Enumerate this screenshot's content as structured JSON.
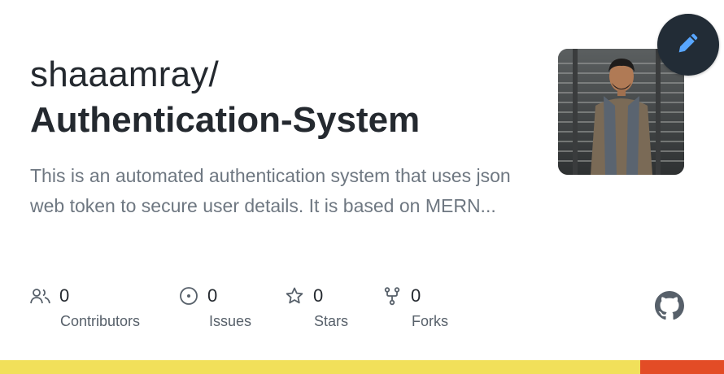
{
  "repo": {
    "owner": "shaaamray/",
    "name": "Authentication-System",
    "description": "This is an automated authentication system that uses json web token to secure user details. It is based on MERN..."
  },
  "stats": [
    {
      "icon": "people-icon",
      "count": "0",
      "label": "Contributors"
    },
    {
      "icon": "issue-icon",
      "count": "0",
      "label": "Issues"
    },
    {
      "icon": "star-icon",
      "count": "0",
      "label": "Stars"
    },
    {
      "icon": "fork-icon",
      "count": "0",
      "label": "Forks"
    }
  ],
  "languages": [
    {
      "color": "#f1e05a",
      "fraction": 0.884
    },
    {
      "color": "#e34c26",
      "fraction": 0.116
    }
  ],
  "colors": {
    "fab_bg": "#222c36",
    "fab_icon": "#58a6ff",
    "text_primary": "#24292f",
    "text_muted": "#6e7781"
  },
  "icons": {
    "edit": "pencil-icon",
    "brand": "github-icon"
  }
}
